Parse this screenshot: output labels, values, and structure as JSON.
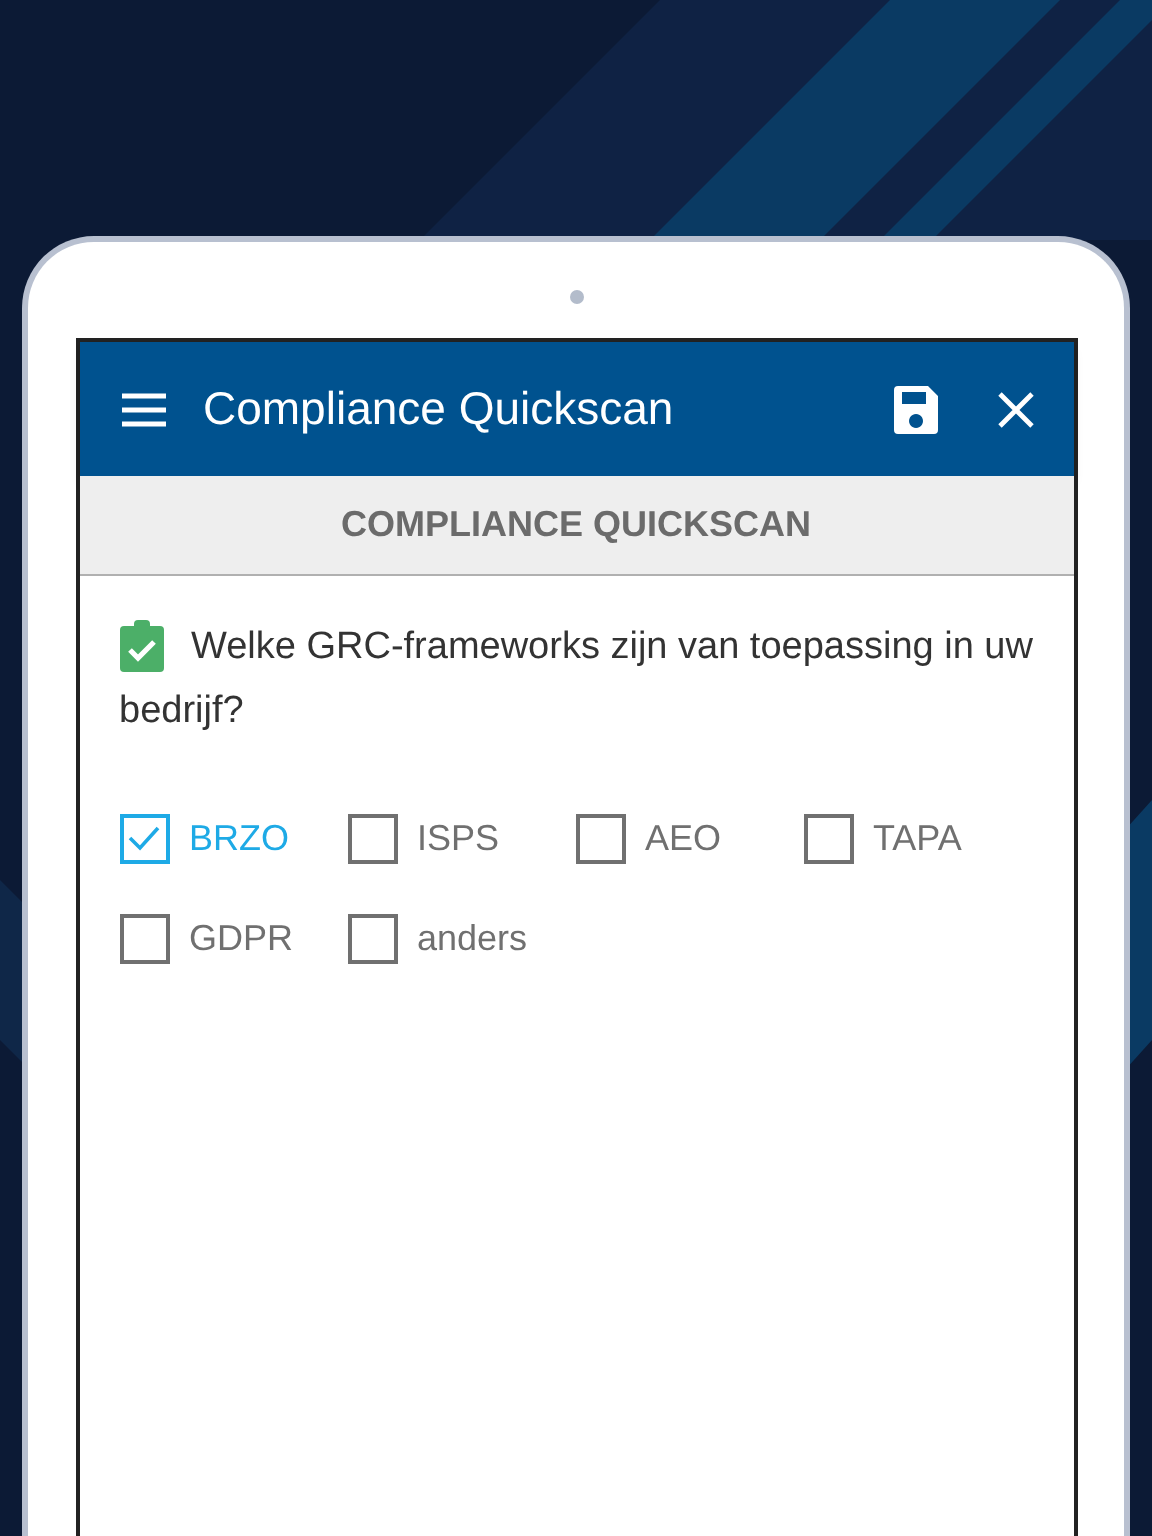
{
  "app_bar": {
    "title": "Compliance Quickscan"
  },
  "section_header": "COMPLIANCE QUICKSCAN",
  "question": {
    "text": "Welke GRC-frameworks zijn van toepassing in uw bedrijf?",
    "answered": true
  },
  "options": [
    {
      "label": "BRZO",
      "checked": true
    },
    {
      "label": "ISPS",
      "checked": false
    },
    {
      "label": "AEO",
      "checked": false
    },
    {
      "label": "TAPA",
      "checked": false
    },
    {
      "label": "GDPR",
      "checked": false
    },
    {
      "label": "anders",
      "checked": false
    }
  ]
}
